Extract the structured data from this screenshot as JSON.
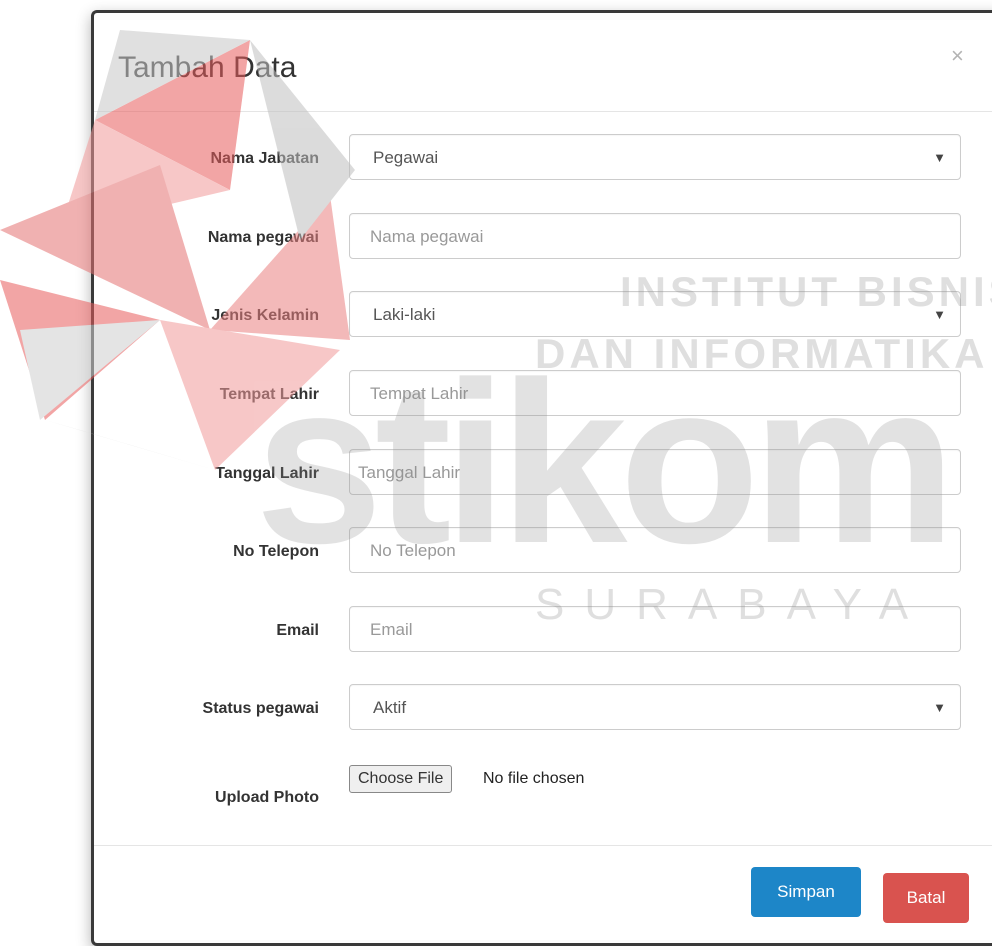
{
  "modal": {
    "title": "Tambah Data",
    "close_glyph": "×"
  },
  "form": {
    "nama_jabatan": {
      "label": "Nama Jabatan",
      "value": "Pegawai"
    },
    "nama_pegawai": {
      "label": "Nama pegawai",
      "placeholder": "Nama pegawai"
    },
    "jenis_kelamin": {
      "label": "Jenis Kelamin",
      "value": "Laki-laki"
    },
    "tempat_lahir": {
      "label": "Tempat Lahir",
      "placeholder": "Tempat Lahir"
    },
    "tanggal_lahir": {
      "label": "Tanggal Lahir",
      "placeholder": "Tanggal Lahir"
    },
    "no_telepon": {
      "label": "No Telepon",
      "placeholder": "No Telepon"
    },
    "email": {
      "label": "Email",
      "placeholder": "Email"
    },
    "status_pegawai": {
      "label": "Status pegawai",
      "value": "Aktif"
    },
    "upload_photo": {
      "label": "Upload Photo",
      "button": "Choose File",
      "status": "No file chosen"
    }
  },
  "caret_glyph": "▼",
  "buttons": {
    "save": "Simpan",
    "cancel": "Batal"
  },
  "watermark": {
    "line1": "INSTITUT BISNIS",
    "line2": "DAN INFORMATIKA",
    "brand": "stikom",
    "city": "SURABAYA"
  },
  "colors": {
    "primary": "#1d86c8",
    "danger": "#d9534f"
  }
}
